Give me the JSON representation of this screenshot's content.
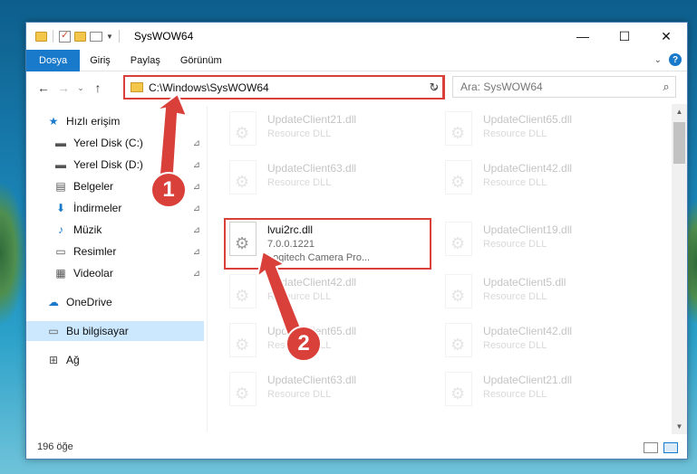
{
  "window": {
    "title": "SysWOW64",
    "min": "—",
    "max": "☐",
    "close": "✕"
  },
  "ribbon": {
    "tabs": [
      "Dosya",
      "Giriş",
      "Paylaş",
      "Görünüm"
    ],
    "help": "?"
  },
  "address": {
    "path": "C:\\Windows\\SysWOW64",
    "refresh": "↻"
  },
  "search": {
    "placeholder": "Ara: SysWOW64"
  },
  "nav": {
    "items": [
      {
        "label": "Hızlı erişim",
        "icon": "star-icon",
        "glyph": "★",
        "pin": false
      },
      {
        "label": "Yerel Disk (C:)",
        "icon": "drive-icon",
        "glyph": "▬",
        "pin": true
      },
      {
        "label": "Yerel Disk (D:)",
        "icon": "drive-icon",
        "glyph": "▬",
        "pin": true
      },
      {
        "label": "Belgeler",
        "icon": "document-icon",
        "glyph": "▤",
        "pin": true
      },
      {
        "label": "İndirmeler",
        "icon": "download-icon",
        "glyph": "⬇",
        "pin": true
      },
      {
        "label": "Müzik",
        "icon": "music-icon",
        "glyph": "♪",
        "pin": true
      },
      {
        "label": "Resimler",
        "icon": "pictures-icon",
        "glyph": "▭",
        "pin": true
      },
      {
        "label": "Videolar",
        "icon": "video-icon",
        "glyph": "▦",
        "pin": true
      },
      {
        "label": "OneDrive",
        "icon": "cloud-icon",
        "glyph": "☁",
        "pin": false
      },
      {
        "label": "Bu bilgisayar",
        "icon": "computer-icon",
        "glyph": "▭",
        "pin": false
      },
      {
        "label": "Ağ",
        "icon": "network-icon",
        "glyph": "⊞",
        "pin": false
      }
    ],
    "pin_glyph": "📌"
  },
  "files": {
    "left": [
      {
        "name": "UpdateClient21.dll",
        "desc": "Resource DLL",
        "faded": true
      },
      {
        "name": "UpdateClient63.dll",
        "desc": "Resource DLL",
        "faded": true
      },
      {
        "name": "lvui2rc.dll",
        "version": "7.0.0.1221",
        "desc": "Logitech Camera Pro...",
        "faded": false
      },
      {
        "name": "UpdateClient42.dll",
        "desc": "Resource DLL",
        "faded": true
      },
      {
        "name": "UpdateClient65.dll",
        "desc": "Resource DLL",
        "faded": true
      },
      {
        "name": "UpdateClient63.dll",
        "desc": "Resource DLL",
        "faded": true
      }
    ],
    "right": [
      {
        "name": "UpdateClient65.dll",
        "desc": "Resource DLL",
        "faded": true
      },
      {
        "name": "UpdateClient42.dll",
        "desc": "Resource DLL",
        "faded": true
      },
      {
        "name": "UpdateClient19.dll",
        "desc": "Resource DLL",
        "faded": true
      },
      {
        "name": "UpdateClient5.dll",
        "desc": "Resource DLL",
        "faded": true
      },
      {
        "name": "UpdateClient42.dll",
        "desc": "Resource DLL",
        "faded": true
      },
      {
        "name": "UpdateClient21.dll",
        "desc": "Resource DLL",
        "faded": true
      }
    ]
  },
  "status": {
    "count": "196 öğe"
  },
  "callouts": [
    "1",
    "2"
  ],
  "colors": {
    "accent": "#1979ca",
    "highlight": "#d9403a",
    "selection": "#cce8ff"
  }
}
